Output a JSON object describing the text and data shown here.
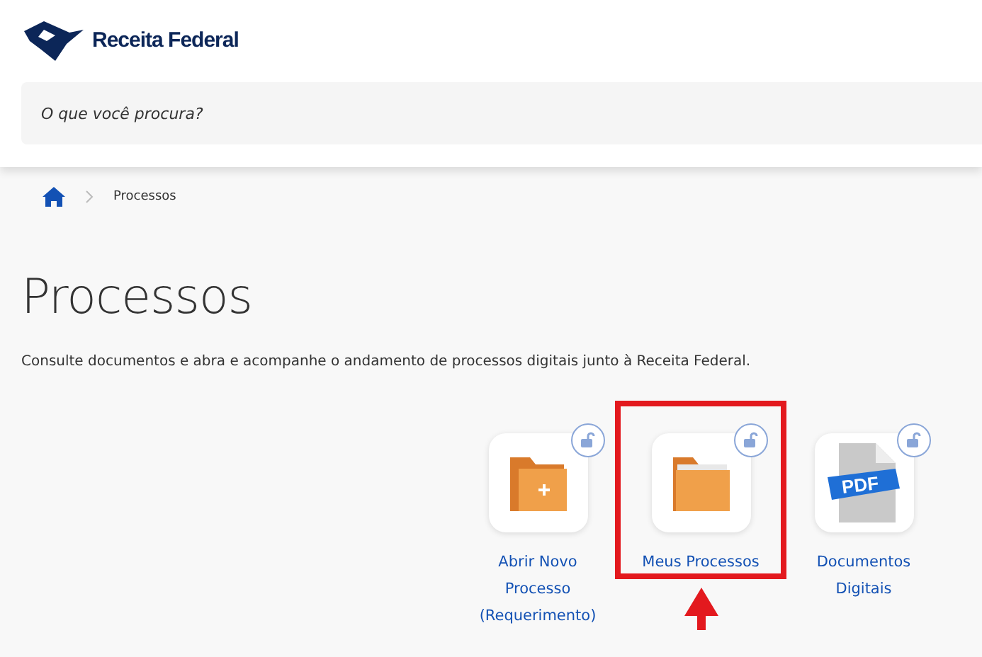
{
  "header": {
    "logo_text": "Receita Federal",
    "search": {
      "placeholder": "O que você procura?"
    }
  },
  "breadcrumb": [
    "Processos"
  ],
  "page": {
    "title": "Processos",
    "description": "Consulte documentos e abra e acompanhe o andamento de processos digitais junto à Receita Federal."
  },
  "services": [
    {
      "kind": "folder-plus",
      "label": "Abrir Novo Processo (Requerimento)",
      "highlighted": false
    },
    {
      "kind": "folder",
      "label": "Meus Processos",
      "highlighted": true
    },
    {
      "kind": "pdf",
      "icon_text": "PDF",
      "label": "Documentos Digitais",
      "highlighted": false
    }
  ]
}
